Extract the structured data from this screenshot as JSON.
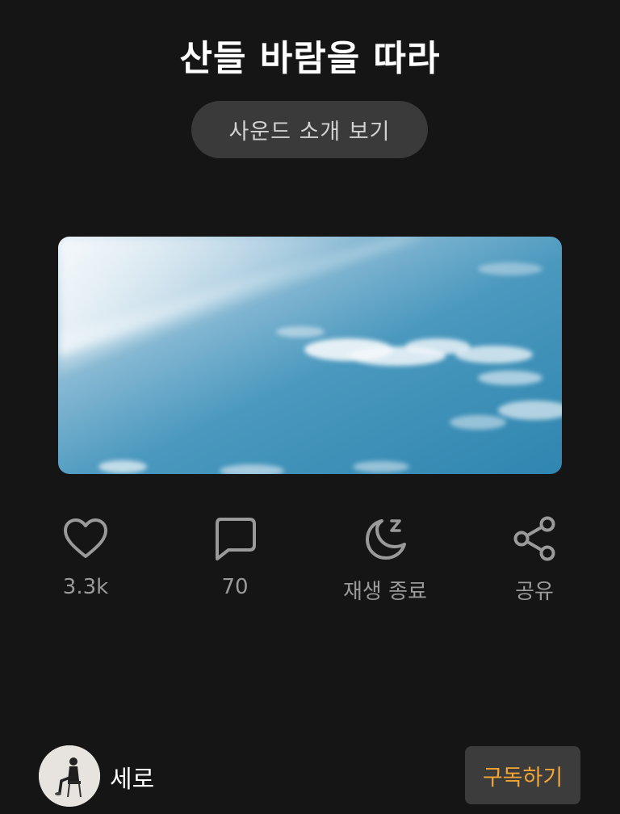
{
  "header": {
    "title": "산들 바람을 따라"
  },
  "intro_button": {
    "label": "사운드 소개 보기"
  },
  "actions": [
    {
      "icon": "heart-icon",
      "label": "3.3k"
    },
    {
      "icon": "comment-icon",
      "label": "70"
    },
    {
      "icon": "moon-sleep-icon",
      "label": "재생 종료"
    },
    {
      "icon": "share-icon",
      "label": "공유"
    }
  ],
  "creator": {
    "name": "세로",
    "subscribe_label": "구독하기"
  },
  "colors": {
    "background": "#151515",
    "accent": "#f3a533",
    "muted": "#9a9a9a",
    "sky": "#3f8fb5"
  }
}
